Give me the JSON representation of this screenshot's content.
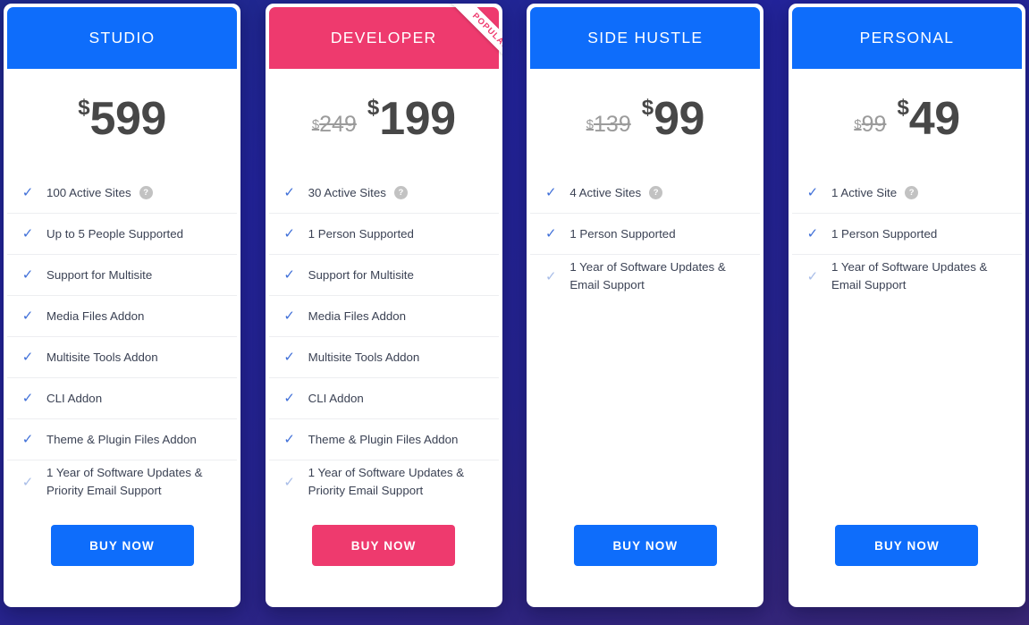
{
  "theme": {
    "blue": "#0e6dfb",
    "pink": "#ee3a6e",
    "background_top": "#1f2a8c",
    "background_bottom": "#3a2775",
    "tick_color": "#3f6fd8",
    "text_color": "#3b4254",
    "price_color": "#474747",
    "old_price_color": "#9b9b9b"
  },
  "help_icon_label": "?",
  "tick_icon": "✓",
  "plans": [
    {
      "name": "STUDIO",
      "accent": "blue",
      "popular": false,
      "ribbon_label": "",
      "old_price": "",
      "currency": "$",
      "price": "599",
      "features": [
        {
          "text": "100 Active Sites",
          "help": true,
          "faded": false,
          "rule": true
        },
        {
          "text": "Up to 5 People Supported",
          "help": false,
          "faded": false,
          "rule": true
        },
        {
          "text": "Support for Multisite",
          "help": false,
          "faded": false,
          "rule": true
        },
        {
          "text": "Media Files Addon",
          "help": false,
          "faded": false,
          "rule": true
        },
        {
          "text": "Multisite Tools Addon",
          "help": false,
          "faded": false,
          "rule": true
        },
        {
          "text": "CLI Addon",
          "help": false,
          "faded": false,
          "rule": true
        },
        {
          "text": "Theme & Plugin Files Addon",
          "help": false,
          "faded": false,
          "rule": true
        },
        {
          "text": "1 Year of Software Updates & Priority Email Support",
          "help": false,
          "faded": true,
          "rule": false
        }
      ],
      "cta_label": "BUY NOW"
    },
    {
      "name": "DEVELOPER",
      "accent": "pink",
      "popular": true,
      "ribbon_label": "POPULAR",
      "old_price": "249",
      "currency": "$",
      "price": "199",
      "features": [
        {
          "text": "30 Active Sites",
          "help": true,
          "faded": false,
          "rule": true
        },
        {
          "text": "1 Person Supported",
          "help": false,
          "faded": false,
          "rule": true
        },
        {
          "text": "Support for Multisite",
          "help": false,
          "faded": false,
          "rule": true
        },
        {
          "text": "Media Files Addon",
          "help": false,
          "faded": false,
          "rule": true
        },
        {
          "text": "Multisite Tools Addon",
          "help": false,
          "faded": false,
          "rule": true
        },
        {
          "text": "CLI Addon",
          "help": false,
          "faded": false,
          "rule": true
        },
        {
          "text": "Theme & Plugin Files Addon",
          "help": false,
          "faded": false,
          "rule": true
        },
        {
          "text": "1 Year of Software Updates & Priority Email Support",
          "help": false,
          "faded": true,
          "rule": false
        }
      ],
      "cta_label": "BUY NOW"
    },
    {
      "name": "SIDE HUSTLE",
      "accent": "blue",
      "popular": false,
      "ribbon_label": "",
      "old_price": "139",
      "currency": "$",
      "price": "99",
      "features": [
        {
          "text": "4 Active Sites",
          "help": true,
          "faded": false,
          "rule": true
        },
        {
          "text": "1 Person Supported",
          "help": false,
          "faded": false,
          "rule": true
        },
        {
          "text": "1 Year of Software Updates & Email Support",
          "help": false,
          "faded": true,
          "rule": false
        }
      ],
      "cta_label": "BUY NOW"
    },
    {
      "name": "PERSONAL",
      "accent": "blue",
      "popular": false,
      "ribbon_label": "",
      "old_price": "99",
      "currency": "$",
      "price": "49",
      "features": [
        {
          "text": "1 Active Site",
          "help": true,
          "faded": false,
          "rule": true
        },
        {
          "text": "1 Person Supported",
          "help": false,
          "faded": false,
          "rule": true
        },
        {
          "text": "1 Year of Software Updates & Email Support",
          "help": false,
          "faded": true,
          "rule": false
        }
      ],
      "cta_label": "BUY NOW"
    }
  ]
}
